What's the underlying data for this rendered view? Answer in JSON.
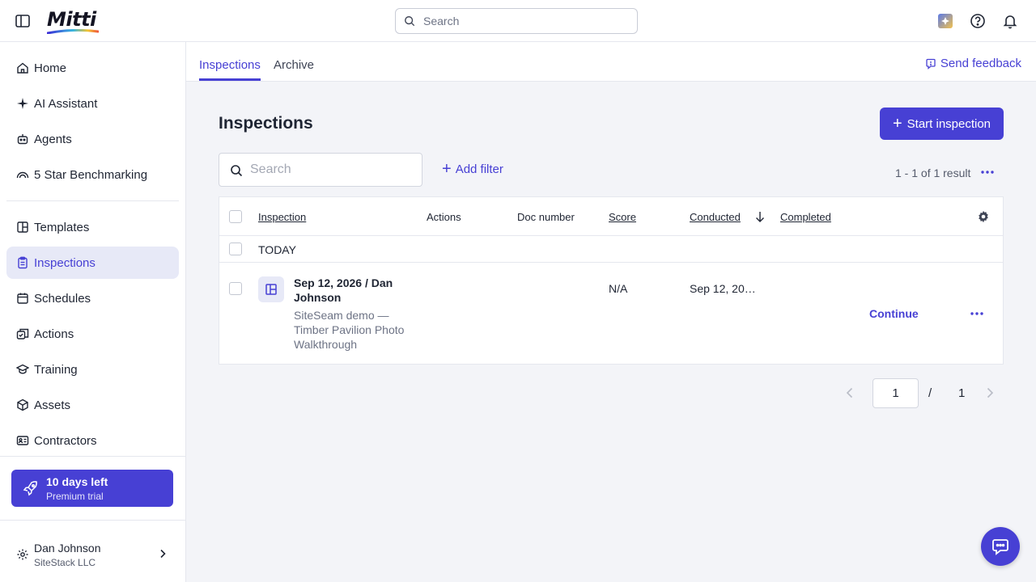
{
  "colors": {
    "accent": "#4740d4",
    "accent_light": "#e7e9f7",
    "page_bg": "#f3f4f8"
  },
  "topbar": {
    "brand": "Mitti",
    "search_placeholder": "Search",
    "icons": [
      "sidebar-toggle-icon",
      "search-icon",
      "app-badge-icon",
      "help-icon",
      "bell-icon"
    ]
  },
  "sidebar": {
    "items": [
      {
        "label": "Home",
        "icon": "home-icon"
      },
      {
        "label": "AI Assistant",
        "icon": "sparkle-icon"
      },
      {
        "label": "Agents",
        "icon": "robot-icon"
      },
      {
        "label": "5 Star Benchmarking",
        "icon": "gauge-icon"
      },
      {
        "label": "Templates",
        "icon": "template-icon"
      },
      {
        "label": "Inspections",
        "icon": "clipboard-icon",
        "active": true
      },
      {
        "label": "Schedules",
        "icon": "calendar-icon"
      },
      {
        "label": "Actions",
        "icon": "actions-icon"
      },
      {
        "label": "Training",
        "icon": "graduation-cap-icon"
      },
      {
        "label": "Assets",
        "icon": "cube-icon"
      },
      {
        "label": "Contractors",
        "icon": "id-card-icon"
      }
    ],
    "trial": {
      "title": "10 days left",
      "subtitle": "Premium trial"
    },
    "user": {
      "name": "Dan Johnson",
      "org": "SiteStack LLC"
    }
  },
  "tabs": [
    {
      "label": "Inspections",
      "active": true
    },
    {
      "label": "Archive",
      "active": false
    }
  ],
  "feedback_label": "Send feedback",
  "page": {
    "title": "Inspections",
    "start_button": "Start inspection",
    "search_placeholder": "Search",
    "add_filter": "Add filter",
    "result_count": "1 - 1 of 1 result"
  },
  "table": {
    "columns": [
      "Inspection",
      "Actions",
      "Doc number",
      "Score",
      "Conducted",
      "Completed"
    ],
    "sort_column": "Conducted",
    "sort_direction": "descending",
    "group_label": "TODAY",
    "rows": [
      {
        "title": "Sep 12, 2026 / Dan Johnson",
        "subtitle": "SiteSeam demo — Timber Pavilion Photo Walkthrough",
        "actions": "",
        "doc_number": "",
        "score": "N/A",
        "conducted": "Sep 12, 20…",
        "completed": "",
        "action_label": "Continue"
      }
    ]
  },
  "pagination": {
    "current": "1",
    "separator": "/",
    "total": "1"
  }
}
